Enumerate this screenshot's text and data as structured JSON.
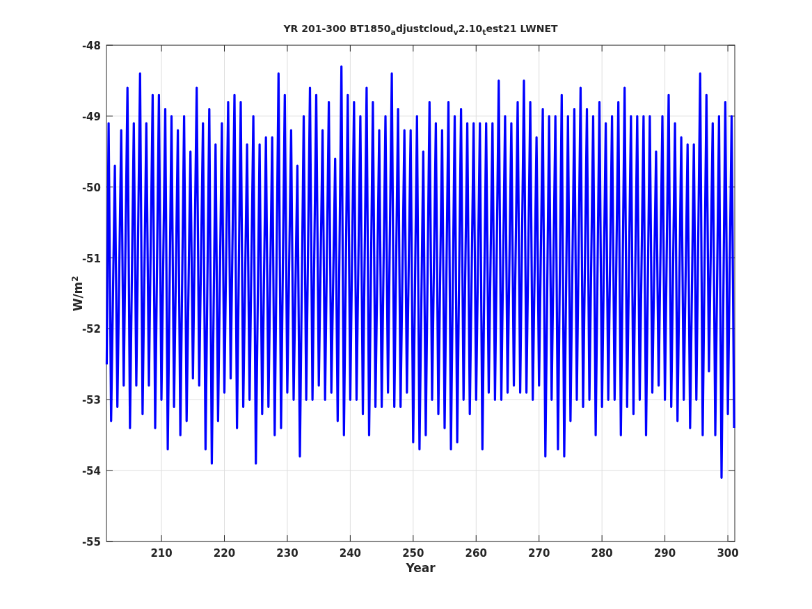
{
  "figure": {
    "chart_data": {
      "type": "line",
      "title": "YR 201-300 BT1850$_{a}$djustcloud$_{v}$2.10$_{t}$est21 LWNET",
      "xlabel": "Year",
      "ylabel": "W/m$^{2}$",
      "grid": true,
      "xlim": [
        201.26,
        301.1
      ],
      "ylim": [
        -55,
        -48
      ],
      "xticks": [
        210,
        220,
        230,
        240,
        250,
        260,
        270,
        280,
        290,
        300
      ],
      "yticks": [
        -48,
        -49,
        -50,
        -51,
        -52,
        -53,
        -54,
        -55
      ],
      "x": [
        201.3,
        201.6,
        202,
        202.6,
        203,
        203.6,
        204,
        204.6,
        205,
        205.6,
        206,
        206.6,
        207,
        207.6,
        208,
        208.6,
        209,
        209.6,
        210,
        210.6,
        211,
        211.6,
        212,
        212.6,
        213,
        213.6,
        214,
        214.6,
        215,
        215.6,
        216,
        216.6,
        217,
        217.6,
        218,
        218.6,
        219,
        219.6,
        220,
        220.6,
        221,
        221.6,
        222,
        222.6,
        223,
        223.6,
        224,
        224.6,
        225,
        225.6,
        226,
        226.6,
        227,
        227.6,
        228,
        228.6,
        229,
        229.6,
        230,
        230.6,
        231,
        231.6,
        232,
        232.6,
        233,
        233.6,
        234,
        234.6,
        235,
        235.6,
        236,
        236.6,
        237,
        237.6,
        238,
        238.6,
        239,
        239.6,
        240,
        240.6,
        241,
        241.6,
        242,
        242.6,
        243,
        243.6,
        244,
        244.6,
        245,
        245.6,
        246,
        246.6,
        247,
        247.6,
        248,
        248.6,
        249,
        249.6,
        250,
        250.6,
        251,
        251.6,
        252,
        252.6,
        253,
        253.6,
        254,
        254.6,
        255,
        255.6,
        256,
        256.6,
        257,
        257.6,
        258,
        258.6,
        259,
        259.6,
        260,
        260.6,
        261,
        261.6,
        262,
        262.6,
        263,
        263.6,
        264,
        264.6,
        265,
        265.6,
        266,
        266.6,
        267,
        267.6,
        268,
        268.6,
        269,
        269.6,
        270,
        270.6,
        271,
        271.6,
        272,
        272.6,
        273,
        273.6,
        274,
        274.6,
        275,
        275.6,
        276,
        276.6,
        277,
        277.6,
        278,
        278.6,
        279,
        279.6,
        280,
        280.6,
        281,
        281.6,
        282,
        282.6,
        283,
        283.6,
        284,
        284.6,
        285,
        285.6,
        286,
        286.6,
        287,
        287.6,
        288,
        288.6,
        289,
        289.6,
        290,
        290.6,
        291,
        291.6,
        292,
        292.6,
        293,
        293.6,
        294,
        294.6,
        295,
        295.6,
        296,
        296.6,
        297,
        297.6,
        298,
        298.6,
        299,
        299.6,
        300,
        300.6,
        301
      ],
      "series": [
        {
          "color": "#0000ff",
          "values": [
            -52.5,
            -49.1,
            -53.3,
            -49.7,
            -53.1,
            -49.2,
            -52.8,
            -48.6,
            -53.4,
            -49.1,
            -52.8,
            -48.4,
            -53.2,
            -49.1,
            -52.8,
            -48.7,
            -53.4,
            -48.7,
            -53.0,
            -48.9,
            -53.7,
            -49.0,
            -53.1,
            -49.2,
            -53.5,
            -49.0,
            -53.3,
            -49.5,
            -52.7,
            -48.6,
            -52.8,
            -49.1,
            -53.7,
            -48.9,
            -53.9,
            -49.4,
            -53.3,
            -49.1,
            -52.9,
            -48.8,
            -52.7,
            -48.7,
            -53.4,
            -48.8,
            -53.1,
            -49.4,
            -53.0,
            -49.0,
            -53.9,
            -49.4,
            -53.2,
            -49.3,
            -53.1,
            -49.3,
            -53.5,
            -48.4,
            -53.4,
            -48.7,
            -52.9,
            -49.2,
            -53.0,
            -49.7,
            -53.8,
            -49.0,
            -53.0,
            -48.6,
            -53.0,
            -48.7,
            -52.8,
            -49.2,
            -53.0,
            -48.8,
            -52.9,
            -49.6,
            -53.3,
            -48.3,
            -53.5,
            -48.7,
            -53.0,
            -48.8,
            -53.0,
            -49.0,
            -53.2,
            -48.6,
            -53.5,
            -48.8,
            -53.1,
            -49.2,
            -53.1,
            -49.0,
            -52.9,
            -48.4,
            -53.1,
            -48.9,
            -53.1,
            -49.2,
            -52.9,
            -49.2,
            -53.6,
            -49.0,
            -53.7,
            -49.5,
            -53.5,
            -48.8,
            -53.0,
            -49.1,
            -53.2,
            -49.2,
            -53.4,
            -48.8,
            -53.7,
            -49.0,
            -53.6,
            -48.9,
            -53.0,
            -49.1,
            -53.2,
            -49.1,
            -53.0,
            -49.1,
            -53.7,
            -49.1,
            -52.9,
            -49.1,
            -53.0,
            -48.5,
            -53.0,
            -49.0,
            -52.9,
            -49.1,
            -52.8,
            -48.8,
            -52.9,
            -48.5,
            -52.9,
            -48.8,
            -53.0,
            -49.3,
            -52.8,
            -48.9,
            -53.8,
            -49.0,
            -53.0,
            -49.0,
            -53.7,
            -48.7,
            -53.8,
            -49.0,
            -53.3,
            -48.9,
            -53.0,
            -48.6,
            -53.1,
            -48.9,
            -53.0,
            -49.0,
            -53.5,
            -48.8,
            -53.1,
            -49.1,
            -53.0,
            -49.0,
            -53.0,
            -48.8,
            -53.5,
            -48.6,
            -53.1,
            -49.0,
            -53.2,
            -49.0,
            -53.0,
            -49.0,
            -53.5,
            -49.0,
            -52.9,
            -49.5,
            -52.8,
            -49.0,
            -53.0,
            -48.7,
            -53.1,
            -49.1,
            -53.3,
            -49.3,
            -53.0,
            -49.4,
            -53.4,
            -49.4,
            -53.0,
            -48.4,
            -53.5,
            -48.7,
            -52.6,
            -49.1,
            -53.5,
            -49.0,
            -54.1,
            -48.8,
            -53.2,
            -49.0,
            -53.4
          ]
        }
      ]
    }
  }
}
